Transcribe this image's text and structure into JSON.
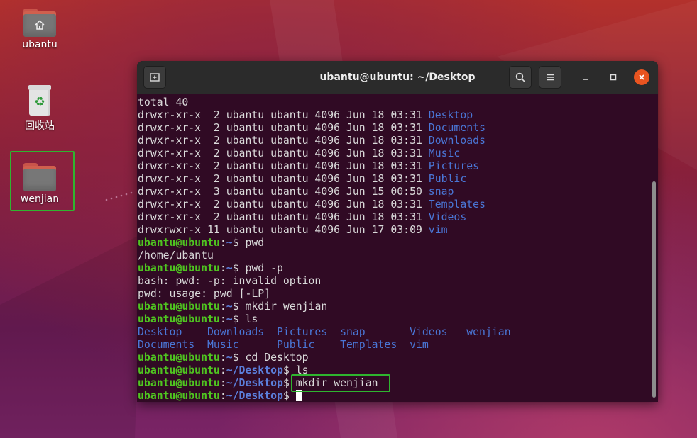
{
  "desktop": {
    "icons": [
      {
        "label": "ubantu",
        "icon": "home-folder-icon"
      },
      {
        "label": "回收站",
        "icon": "trash-icon"
      },
      {
        "label": "wenjian",
        "icon": "folder-icon"
      }
    ]
  },
  "terminal": {
    "title": "ubantu@ubuntu: ~/Desktop",
    "buttons": {
      "new_tab": "new-tab-icon",
      "search": "search-icon",
      "menu": "hamburger-menu-icon",
      "minimize": "minimize-icon",
      "maximize": "maximize-icon",
      "close": "close-icon"
    },
    "colors": {
      "background": "#300a24",
      "user": "#4fc520",
      "path": "#5b7fdb",
      "dir": "#4a76d6",
      "highlight": "#2fb52f"
    },
    "lines": [
      {
        "t": "total 40"
      },
      {
        "perm": "drwxr-xr-x  2 ubantu ubantu 4096 Jun 18 03:31 ",
        "dir": "Desktop"
      },
      {
        "perm": "drwxr-xr-x  2 ubantu ubantu 4096 Jun 18 03:31 ",
        "dir": "Documents"
      },
      {
        "perm": "drwxr-xr-x  2 ubantu ubantu 4096 Jun 18 03:31 ",
        "dir": "Downloads"
      },
      {
        "perm": "drwxr-xr-x  2 ubantu ubantu 4096 Jun 18 03:31 ",
        "dir": "Music"
      },
      {
        "perm": "drwxr-xr-x  2 ubantu ubantu 4096 Jun 18 03:31 ",
        "dir": "Pictures"
      },
      {
        "perm": "drwxr-xr-x  2 ubantu ubantu 4096 Jun 18 03:31 ",
        "dir": "Public"
      },
      {
        "perm": "drwxr-xr-x  3 ubantu ubantu 4096 Jun 15 00:50 ",
        "dir": "snap"
      },
      {
        "perm": "drwxr-xr-x  2 ubantu ubantu 4096 Jun 18 03:31 ",
        "dir": "Templates"
      },
      {
        "perm": "drwxr-xr-x  2 ubantu ubantu 4096 Jun 18 03:31 ",
        "dir": "Videos"
      },
      {
        "perm": "drwxrwxr-x 11 ubantu ubantu 4096 Jun 17 03:09 ",
        "dir": "vim"
      },
      {
        "user": "ubantu@ubuntu",
        "path": "~",
        "cmd": "$ pwd"
      },
      {
        "t": "/home/ubantu"
      },
      {
        "user": "ubantu@ubuntu",
        "path": "~",
        "cmd": "$ pwd -p"
      },
      {
        "t": "bash: pwd: -p: invalid option"
      },
      {
        "t": "pwd: usage: pwd [-LP]"
      },
      {
        "user": "ubantu@ubuntu",
        "path": "~",
        "cmd": "$ mkdir wenjian"
      },
      {
        "user": "ubantu@ubuntu",
        "path": "~",
        "cmd": "$ ls"
      },
      {
        "dirs": "Desktop    Downloads  Pictures  snap       Videos   wenjian"
      },
      {
        "dirs": "Documents  Music      Public    Templates  vim"
      },
      {
        "user": "ubantu@ubuntu",
        "path": "~",
        "cmd": "$ cd Desktop"
      },
      {
        "user": "ubantu@ubuntu",
        "path": "~/Desktop",
        "cmd": "$ ls"
      },
      {
        "user": "ubantu@ubuntu",
        "path": "~/Desktop",
        "cmd": "$ ",
        "highlight_cmd": "mkdir wenjian"
      },
      {
        "user": "ubantu@ubuntu",
        "path": "~/Desktop",
        "cmd": "$ ",
        "cursor": true
      }
    ]
  }
}
